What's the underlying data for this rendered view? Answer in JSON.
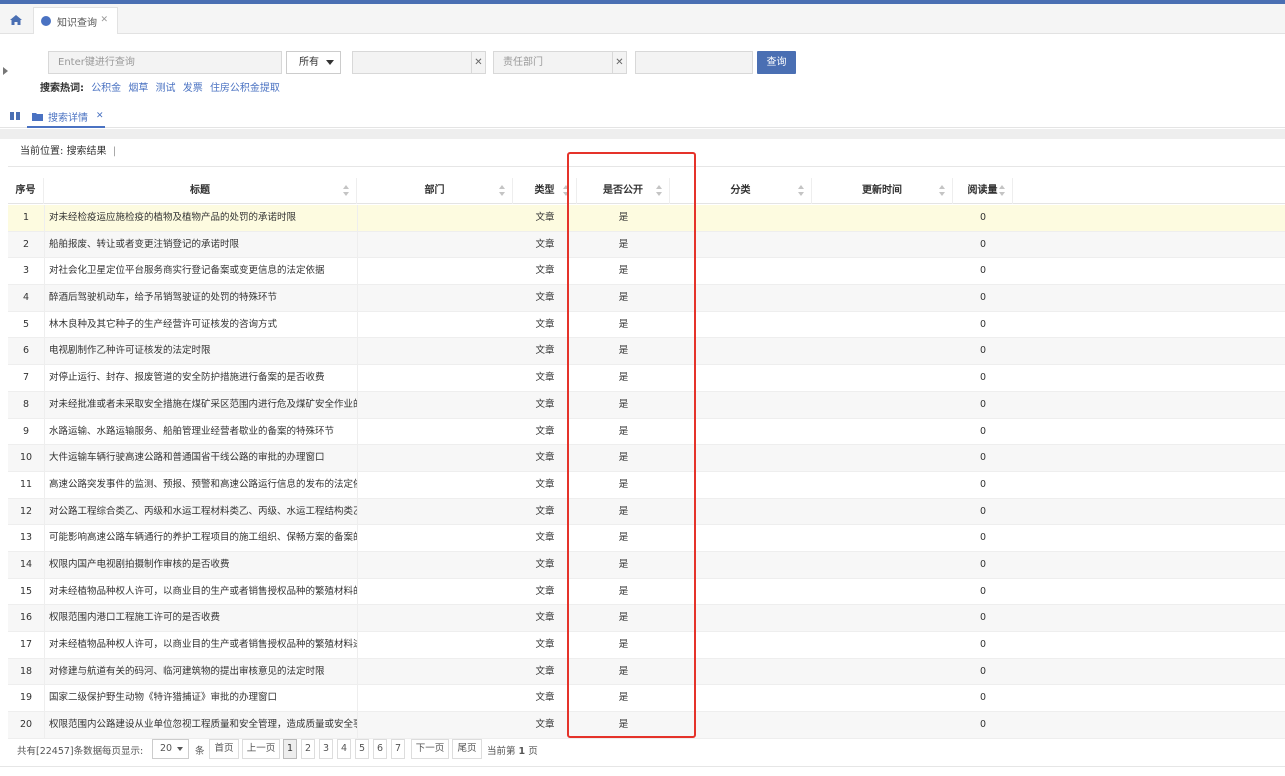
{
  "tabs": {
    "main_tab": "知识查询"
  },
  "search": {
    "keyword_placeholder": "Enter键进行查询",
    "scope_value": "所有",
    "field2_value": "",
    "dept_placeholder": "责任部门",
    "field4_value": "",
    "query_label": "查询",
    "hot_label": "搜索热词:",
    "hot_words": [
      "公积金",
      "烟草",
      "测试",
      "发票",
      "住房公积金提取"
    ]
  },
  "subtab": {
    "label": "搜索详情"
  },
  "breadcrumb": {
    "label": "当前位置:",
    "value": "搜索结果"
  },
  "columns": {
    "no": "序号",
    "title": "标题",
    "dept": "部门",
    "type": "类型",
    "public": "是否公开",
    "category": "分类",
    "updated": "更新时间",
    "reads": "阅读量"
  },
  "rows": [
    {
      "no": "1",
      "title": "对未经检疫运应施检疫的植物及植物产品的处罚的承诺时限",
      "type": "文章",
      "public": "是",
      "reads": "0"
    },
    {
      "no": "2",
      "title": "船舶报废、转让或者变更注销登记的承诺时限",
      "type": "文章",
      "public": "是",
      "reads": "0"
    },
    {
      "no": "3",
      "title": "对社会化卫星定位平台服务商实行登记备案或变更信息的法定依据",
      "type": "文章",
      "public": "是",
      "reads": "0"
    },
    {
      "no": "4",
      "title": "醉酒后驾驶机动车，给予吊销驾驶证的处罚的特殊环节",
      "type": "文章",
      "public": "是",
      "reads": "0"
    },
    {
      "no": "5",
      "title": "林木良种及其它种子的生产经营许可证核发的咨询方式",
      "type": "文章",
      "public": "是",
      "reads": "0"
    },
    {
      "no": "6",
      "title": "电视剧制作乙种许可证核发的法定时限",
      "type": "文章",
      "public": "是",
      "reads": "0"
    },
    {
      "no": "7",
      "title": "对停止运行、封存、报废管道的安全防护措施进行备案的是否收费",
      "type": "文章",
      "public": "是",
      "reads": "0"
    },
    {
      "no": "8",
      "title": "对未经批准或者未采取安全措施在煤矿采区范围内进行危及煤矿安全作业的",
      "type": "文章",
      "public": "是",
      "reads": "0"
    },
    {
      "no": "9",
      "title": "水路运输、水路运输服务、船舶管理业经营者歇业的备案的特殊环节",
      "type": "文章",
      "public": "是",
      "reads": "0"
    },
    {
      "no": "10",
      "title": "大件运输车辆行驶高速公路和普通国省干线公路的审批的办理窗口",
      "type": "文章",
      "public": "是",
      "reads": "0"
    },
    {
      "no": "11",
      "title": "高速公路突发事件的监测、预报、预警和高速公路运行信息的发布的法定依",
      "type": "文章",
      "public": "是",
      "reads": "0"
    },
    {
      "no": "12",
      "title": "对公路工程综合类乙、丙级和水运工程材料类乙、丙级、水运工程结构类乙",
      "type": "文章",
      "public": "是",
      "reads": "0"
    },
    {
      "no": "13",
      "title": "可能影响高速公路车辆通行的养护工程项目的施工组织、保畅方案的备案的",
      "type": "文章",
      "public": "是",
      "reads": "0"
    },
    {
      "no": "14",
      "title": "权限内国产电视剧拍摄制作审核的是否收费",
      "type": "文章",
      "public": "是",
      "reads": "0"
    },
    {
      "no": "15",
      "title": "对未经植物品种权人许可，以商业目的生产或者销售授权品种的繁殖材料的",
      "type": "文章",
      "public": "是",
      "reads": "0"
    },
    {
      "no": "16",
      "title": "权限范围内港口工程施工许可的是否收费",
      "type": "文章",
      "public": "是",
      "reads": "0"
    },
    {
      "no": "17",
      "title": "对未经植物品种权人许可，以商业目的生产或者销售授权品种的繁殖材料进",
      "type": "文章",
      "public": "是",
      "reads": "0"
    },
    {
      "no": "18",
      "title": "对修建与航道有关的码河、临河建筑物的提出审核意见的法定时限",
      "type": "文章",
      "public": "是",
      "reads": "0"
    },
    {
      "no": "19",
      "title": "国家二级保护野生动物《特许猎捕证》审批的办理窗口",
      "type": "文章",
      "public": "是",
      "reads": "0"
    },
    {
      "no": "20",
      "title": "权限范围内公路建设从业单位忽视工程质量和安全管理，造成质量或安全事",
      "type": "文章",
      "public": "是",
      "reads": "0"
    }
  ],
  "pager": {
    "total_text": "共有[22457]条数据",
    "per_page_label": "每页显示:",
    "per_page_value": "20",
    "unit": "条",
    "first": "首页",
    "prev": "上一页",
    "pages": [
      "1",
      "2",
      "3",
      "4",
      "5",
      "6",
      "7"
    ],
    "next": "下一页",
    "last": "尾页",
    "current_prefix": "当前第",
    "current_page": "1",
    "current_suffix": "页"
  }
}
